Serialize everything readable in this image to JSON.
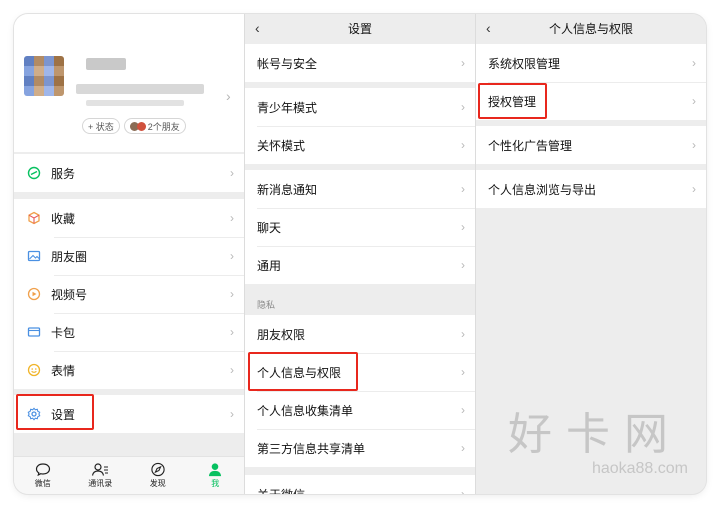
{
  "profile": {
    "chip_status": "+ 状态",
    "chip_friends": "2个朋友"
  },
  "me_menu": {
    "services": "服务",
    "favorites": "收藏",
    "moments": "朋友圈",
    "channels": "视频号",
    "wallet": "卡包",
    "stickers": "表情",
    "settings": "设置"
  },
  "tabbar": {
    "chats": "微信",
    "contacts": "通讯录",
    "discover": "发现",
    "me": "我"
  },
  "settings": {
    "title": "设置",
    "account_security": "帐号与安全",
    "youth_mode": "青少年模式",
    "care_mode": "关怀模式",
    "notifications": "新消息通知",
    "chat": "聊天",
    "general": "通用",
    "privacy_section": "隐私",
    "friend_permissions": "朋友权限",
    "personal_info": "个人信息与权限",
    "info_collection": "个人信息收集清单",
    "third_party": "第三方信息共享清单",
    "about": "关于微信"
  },
  "personal": {
    "title": "个人信息与权限",
    "system_permissions": "系统权限管理",
    "authorization": "授权管理",
    "personalized_ads": "个性化广告管理",
    "browse_export": "个人信息浏览与导出"
  },
  "watermark": {
    "big": "好卡网",
    "small": "haoka88.com"
  },
  "colors": {
    "accent_green": "#07c160",
    "highlight_red": "#e8271d"
  }
}
